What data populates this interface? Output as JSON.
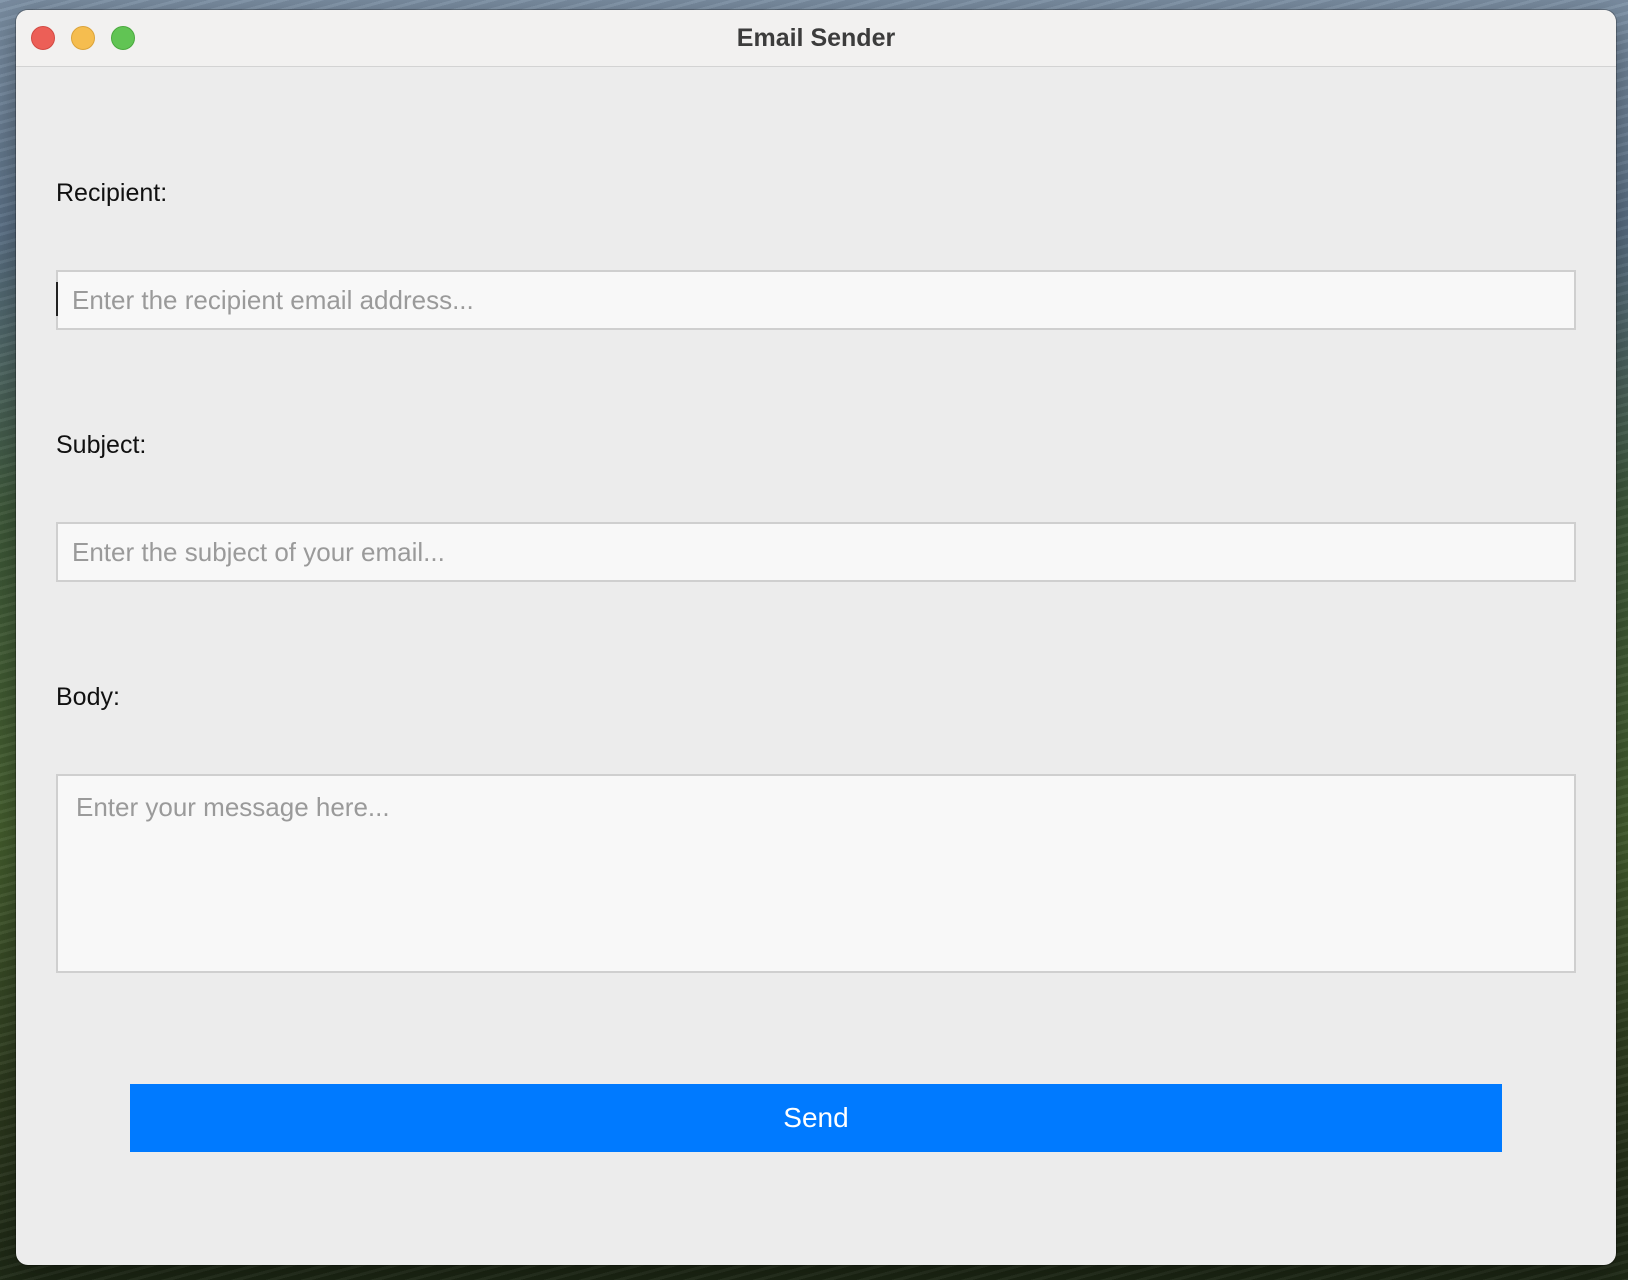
{
  "window": {
    "title": "Email Sender"
  },
  "form": {
    "recipient": {
      "label": "Recipient:",
      "value": "",
      "placeholder": "Enter the recipient email address..."
    },
    "subject": {
      "label": "Subject:",
      "value": "",
      "placeholder": "Enter the subject of your email..."
    },
    "body": {
      "label": "Body:",
      "value": "",
      "placeholder": "Enter your message here..."
    },
    "send_label": "Send"
  },
  "colors": {
    "accent": "#007aff",
    "close": "#ec5f57",
    "minimize": "#f5bd4f",
    "zoom": "#61c454"
  }
}
